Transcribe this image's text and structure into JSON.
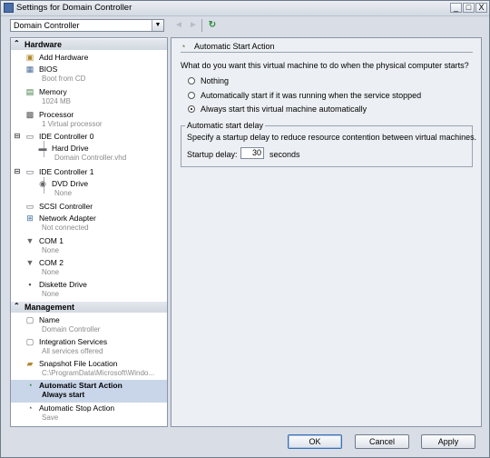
{
  "window": {
    "title": "Settings for Domain Controller",
    "controls": {
      "minimize": "_",
      "maximize": "□",
      "close": "X"
    }
  },
  "toolbar": {
    "vm_selector_value": "Domain Controller",
    "back_glyph": "◄",
    "forward_glyph": "►",
    "refresh_glyph": "↻"
  },
  "nav": {
    "hardware_header": "Hardware",
    "management_header": "Management",
    "hardware_items": [
      {
        "label": "Add Hardware",
        "sub": ""
      },
      {
        "label": "BIOS",
        "sub": "Boot from CD"
      },
      {
        "label": "Memory",
        "sub": "1024 MB"
      },
      {
        "label": "Processor",
        "sub": "1 Virtual processor"
      },
      {
        "label": "IDE Controller 0",
        "sub": ""
      },
      {
        "label": "Hard Drive",
        "sub": "Domain Controller.vhd"
      },
      {
        "label": "IDE Controller 1",
        "sub": ""
      },
      {
        "label": "DVD Drive",
        "sub": "None"
      },
      {
        "label": "SCSI Controller",
        "sub": ""
      },
      {
        "label": "Network Adapter",
        "sub": "Not connected"
      },
      {
        "label": "COM 1",
        "sub": "None"
      },
      {
        "label": "COM 2",
        "sub": "None"
      },
      {
        "label": "Diskette Drive",
        "sub": "None"
      }
    ],
    "management_items": [
      {
        "label": "Name",
        "sub": "Domain Controller"
      },
      {
        "label": "Integration Services",
        "sub": "All services offered"
      },
      {
        "label": "Snapshot File Location",
        "sub": "C:\\ProgramData\\Microsoft\\Windo..."
      },
      {
        "label": "Automatic Start Action",
        "sub": "Always start"
      },
      {
        "label": "Automatic Stop Action",
        "sub": "Save"
      }
    ]
  },
  "panel": {
    "title": "Automatic Start Action",
    "question": "What do you want this virtual machine to do when the physical computer starts?",
    "options": [
      {
        "label": "Nothing",
        "selected": false
      },
      {
        "label": "Automatically start if it was running when the service stopped",
        "selected": false
      },
      {
        "label": "Always start this virtual machine automatically",
        "selected": true
      }
    ],
    "delay_group": {
      "legend": "Automatic start delay",
      "description": "Specify a startup delay to reduce resource contention between virtual machines.",
      "startup_delay_label": "Startup delay:",
      "startup_delay_value": "30",
      "unit": "seconds"
    }
  },
  "buttons": {
    "ok": "OK",
    "cancel": "Cancel",
    "apply": "Apply"
  },
  "colors": {
    "selection": "#c9d6ea",
    "accent": "#3c6fb0",
    "subtext": "#8a8a8a"
  }
}
